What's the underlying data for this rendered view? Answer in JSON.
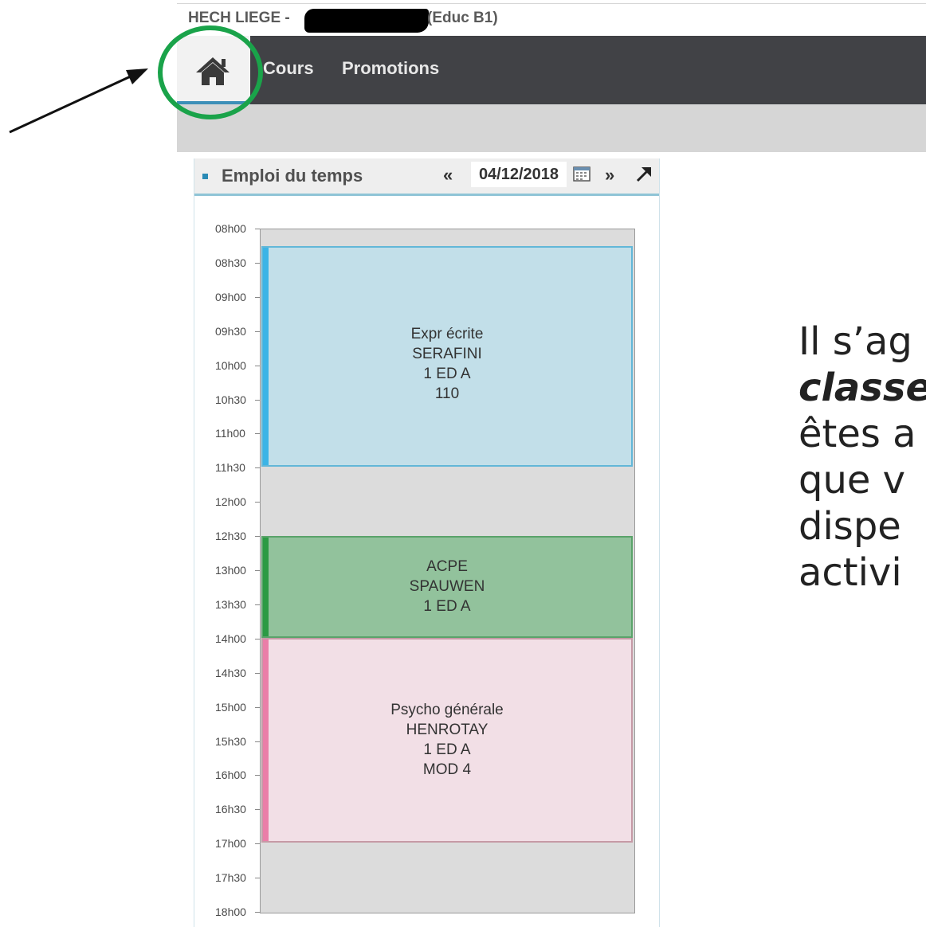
{
  "title_bar": {
    "left_text": "HECH LIEGE -",
    "right_text": "(Educ B1)"
  },
  "nav": {
    "home": "home",
    "items": [
      "Cours",
      "Promotions"
    ]
  },
  "widget": {
    "title": "Emploi du temps",
    "prev": "«",
    "date": "04/12/2018",
    "next": "»",
    "times": [
      "08h00",
      "08h30",
      "09h00",
      "09h30",
      "10h00",
      "10h30",
      "11h00",
      "11h30",
      "12h00",
      "12h30",
      "13h00",
      "13h30",
      "14h00",
      "14h30",
      "15h00",
      "15h30",
      "16h00",
      "16h30",
      "17h00",
      "17h30",
      "18h00"
    ],
    "events": [
      {
        "lines": [
          "Expr écrite",
          "SERAFINI",
          "1 ED A",
          "110"
        ],
        "color": "#c2dfe9",
        "bar": "#3cb4e6",
        "border": "#62b7d8"
      },
      {
        "lines": [
          "ACPE",
          "SPAUWEN",
          "1 ED A"
        ],
        "color": "#92c29c",
        "bar": "#2c9a44",
        "border": "#5aa36a"
      },
      {
        "lines": [
          "Psycho générale",
          "HENROTAY",
          "1 ED A",
          "MOD 4"
        ],
        "color": "#f2dfe6",
        "bar": "#ea7ea8",
        "border": "#c69aa6"
      }
    ]
  },
  "slide": {
    "l1": "Il s’ag",
    "l2": "classe",
    "l3": "êtes a",
    "l4": "que v",
    "l5": "dispe",
    "l6": "activi"
  },
  "colors": {
    "nav_bg": "#414246",
    "accent": "#3d8fb8",
    "annotation": "#1aa34a"
  }
}
